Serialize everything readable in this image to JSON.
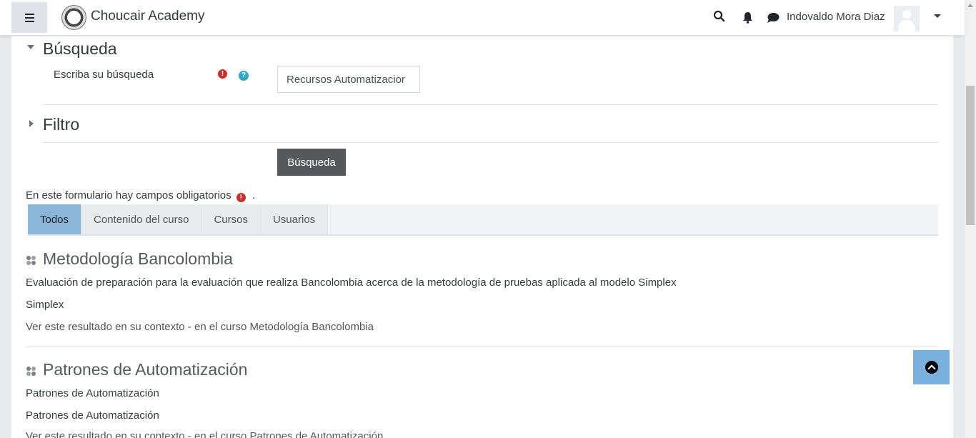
{
  "navbar": {
    "brand": "Choucair Academy",
    "user_name": "Indovaldo Mora Diaz",
    "icons": [
      "menu-icon",
      "search-icon",
      "bell-icon",
      "chat-icon",
      "chevron-down-icon"
    ]
  },
  "form": {
    "search_section_title": "Búsqueda",
    "search_label": "Escriba su búsqueda",
    "search_value": "Recursos Automatizacior",
    "filter_section_title": "Filtro",
    "submit_label": "Búsqueda",
    "required_note": "En este formulario hay campos obligatorios",
    "required_note_end": "."
  },
  "tabs": [
    {
      "label": "Todos",
      "active": true
    },
    {
      "label": "Contenido del curso",
      "active": false
    },
    {
      "label": "Cursos",
      "active": false
    },
    {
      "label": "Usuarios",
      "active": false
    }
  ],
  "results": [
    {
      "title": "Metodología Bancolombia",
      "description": "Evaluación de preparación para la evaluación que realiza Bancolombia acerca de la metodología de pruebas aplicada al modelo Simplex",
      "summary": "Simplex",
      "context": "Ver este resultado en su contexto - en el curso Metodología Bancolombia"
    },
    {
      "title": "Patrones de Automatización",
      "description": "Patrones de Automatización",
      "summary": "Patrones de Automatización",
      "context": "Ver este resultado en su contexto - en el curso Patrones de Automatización"
    }
  ],
  "colors": {
    "active_tab": "#8cb6d9",
    "submit_button": "#55595c",
    "required_icon": "#c9302c",
    "help_icon": "#2ea6c4",
    "scroll_top_button": "#7ab0dd"
  }
}
